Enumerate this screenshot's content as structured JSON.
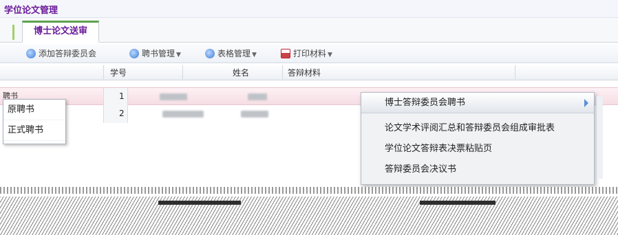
{
  "app": {
    "title": "学位论文管理"
  },
  "tabs": [
    {
      "label": "博士论文送审"
    }
  ],
  "toolbar": {
    "buttons": [
      {
        "label": "添加答辩委员会",
        "icon": "add-icon"
      },
      {
        "label": "聘书管理",
        "icon": "certificate-icon"
      },
      {
        "label": "表格管理",
        "icon": "table-icon"
      },
      {
        "label": "打印材料",
        "icon": "print-icon"
      }
    ]
  },
  "grid": {
    "columns": [
      "学号",
      "姓名",
      "答辩材料"
    ],
    "rows": [
      {
        "index": "1",
        "short": "聘书"
      },
      {
        "index": "2",
        "short": ""
      }
    ]
  },
  "left_menu": {
    "items": [
      "原聘书",
      "正式聘书"
    ]
  },
  "dropdown": {
    "header": "博士答辩委员会聘书",
    "items": [
      "论文学术评阅汇总和答辩委员会组成审批表",
      "学位论文答辩表决票粘贴页",
      "答辩委员会决议书"
    ]
  }
}
